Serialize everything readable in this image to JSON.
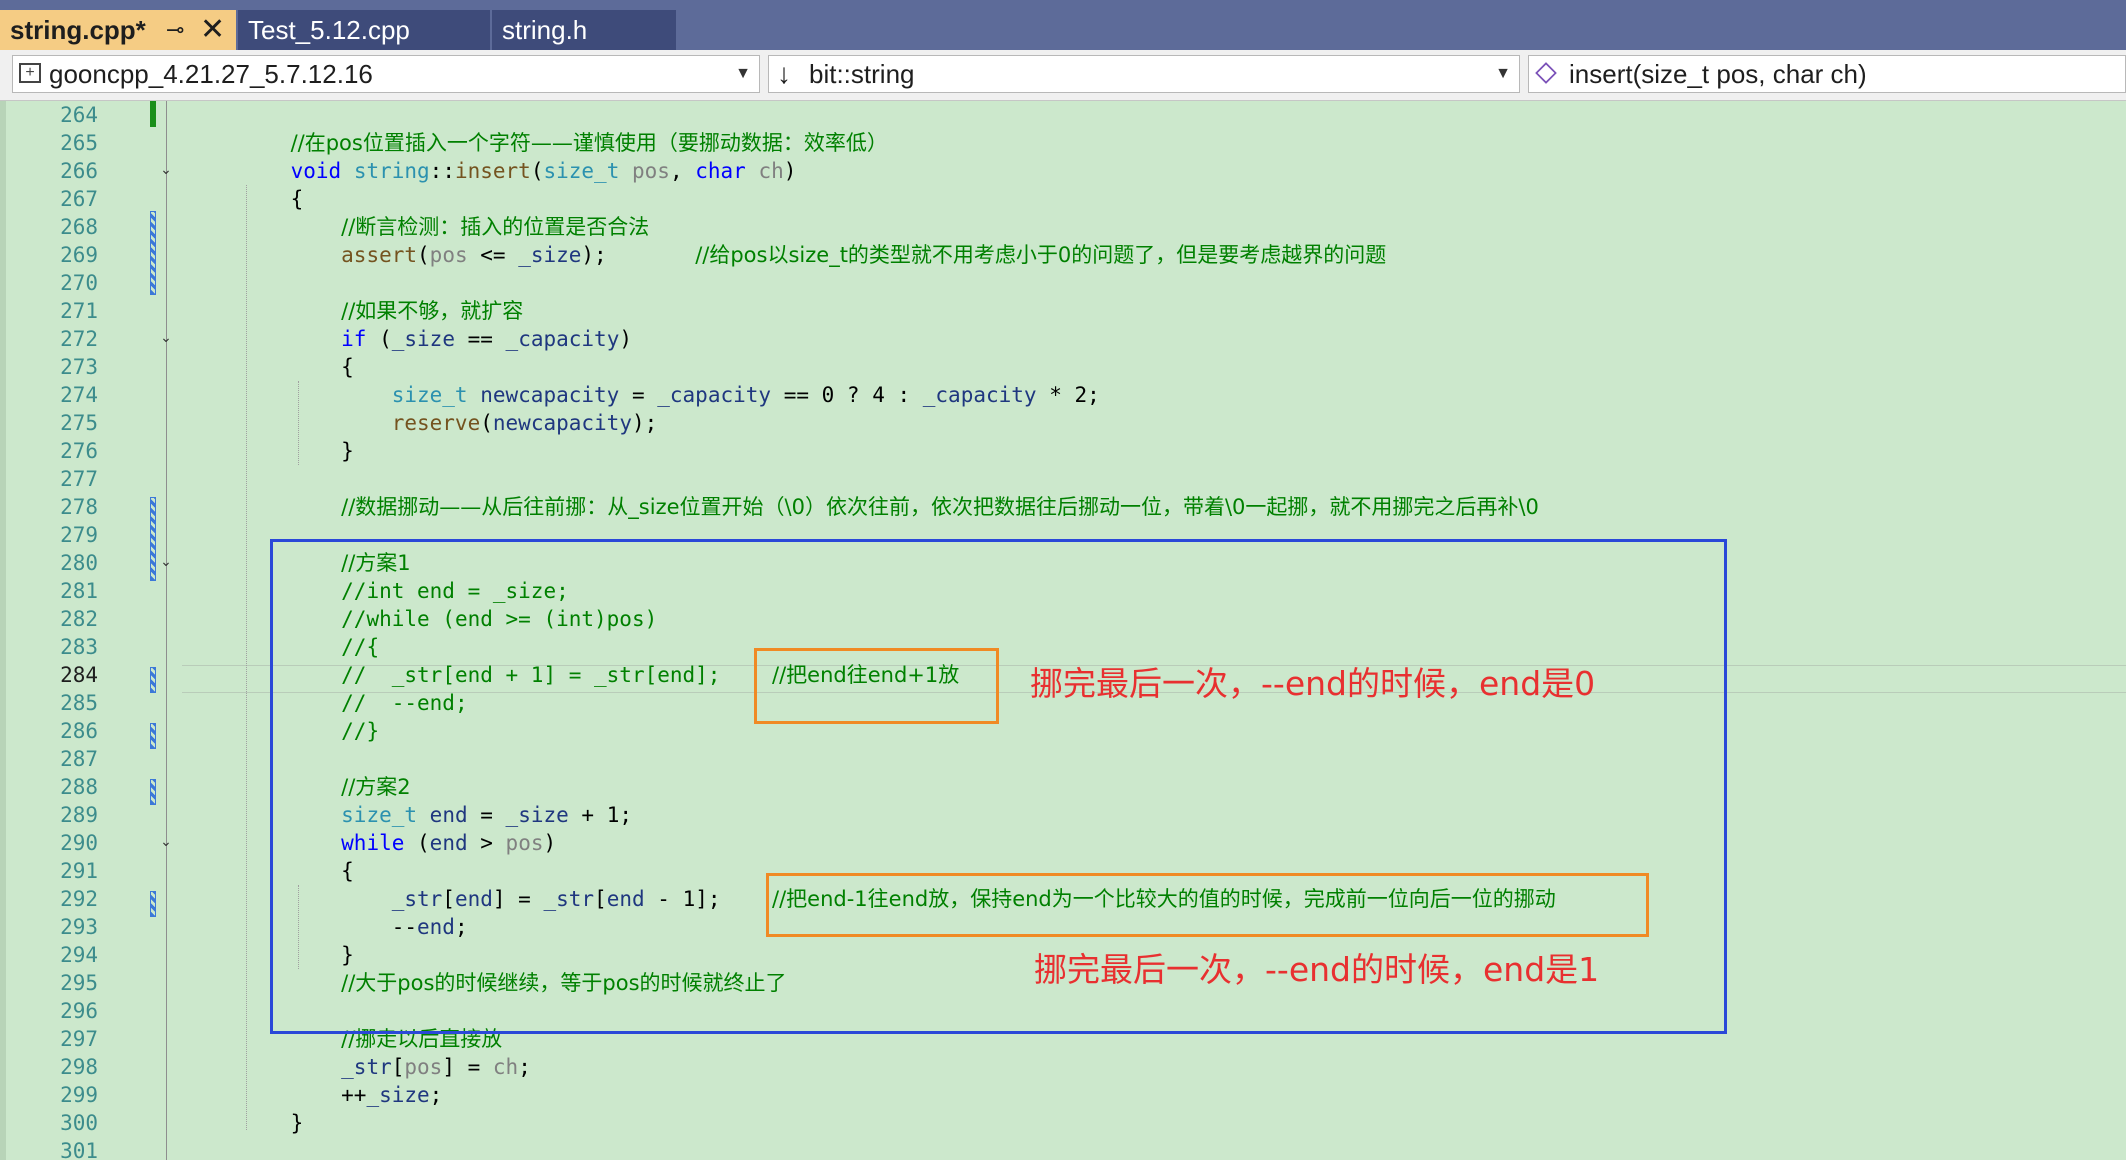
{
  "tabs": [
    {
      "label": "string.cpp*",
      "active": true,
      "pin": "⊸",
      "close": "✕"
    },
    {
      "label": "Test_5.12.cpp",
      "active": false
    },
    {
      "label": "string.h",
      "active": false
    }
  ],
  "navbar": {
    "project": "gooncpp_4.21.27_5.7.12.16",
    "scope": "bit::string",
    "member": "insert(size_t pos, char ch)"
  },
  "line_numbers": [
    "264",
    "265",
    "266",
    "267",
    "268",
    "269",
    "270",
    "271",
    "272",
    "273",
    "274",
    "275",
    "276",
    "277",
    "278",
    "279",
    "280",
    "281",
    "282",
    "283",
    "284",
    "285",
    "286",
    "287",
    "288",
    "289",
    "290",
    "291",
    "292",
    "293",
    "294",
    "295",
    "296",
    "297",
    "298",
    "299",
    "300",
    "301"
  ],
  "current_line": "284",
  "code": {
    "l265": "//在pos位置插入一个字符——谨慎使用（要挪动数据：效率低）",
    "l268": "//断言检测：插入的位置是否合法",
    "l269_comment": "//给pos以size_t的类型就不用考虑小于0的问题了，但是要考虑越界的问题",
    "l271": "//如果不够，就扩容",
    "l278": "//数据挪动——从后往前挪：从_size位置开始（\\0）依次往前，依次把数据往后挪动一位，带着\\0一起挪，就不用挪完之后再补\\0",
    "l280": "//方案1",
    "l281": "//int end = _size;",
    "l282": "//while (end >= (int)pos)",
    "l283": "//{",
    "l284": "//  _str[end + 1] = _str[end];",
    "l284_comment": "//把end往end+1放",
    "l285": "//  --end;",
    "l286": "//}",
    "l288": "//方案2",
    "l292_comment": "//把end-1往end放，保持end为一个比较大的值的时候，完成前一位向后一位的挪动",
    "l295": "//大于pos的时候继续，等于pos的时候就终止了",
    "l297": "//挪走以后直接放"
  },
  "annotations": {
    "note1": "挪完最后一次，--end的时候，end是0",
    "note2": "挪完最后一次，--end的时候，end是1"
  },
  "colors": {
    "tab_active": "#f5cc84",
    "tab_bar": "#5d6b99",
    "editor_bg": "#cce8cc",
    "box_blue": "#2a48d8",
    "box_orange": "#f08a24",
    "note_red": "#e83030"
  }
}
